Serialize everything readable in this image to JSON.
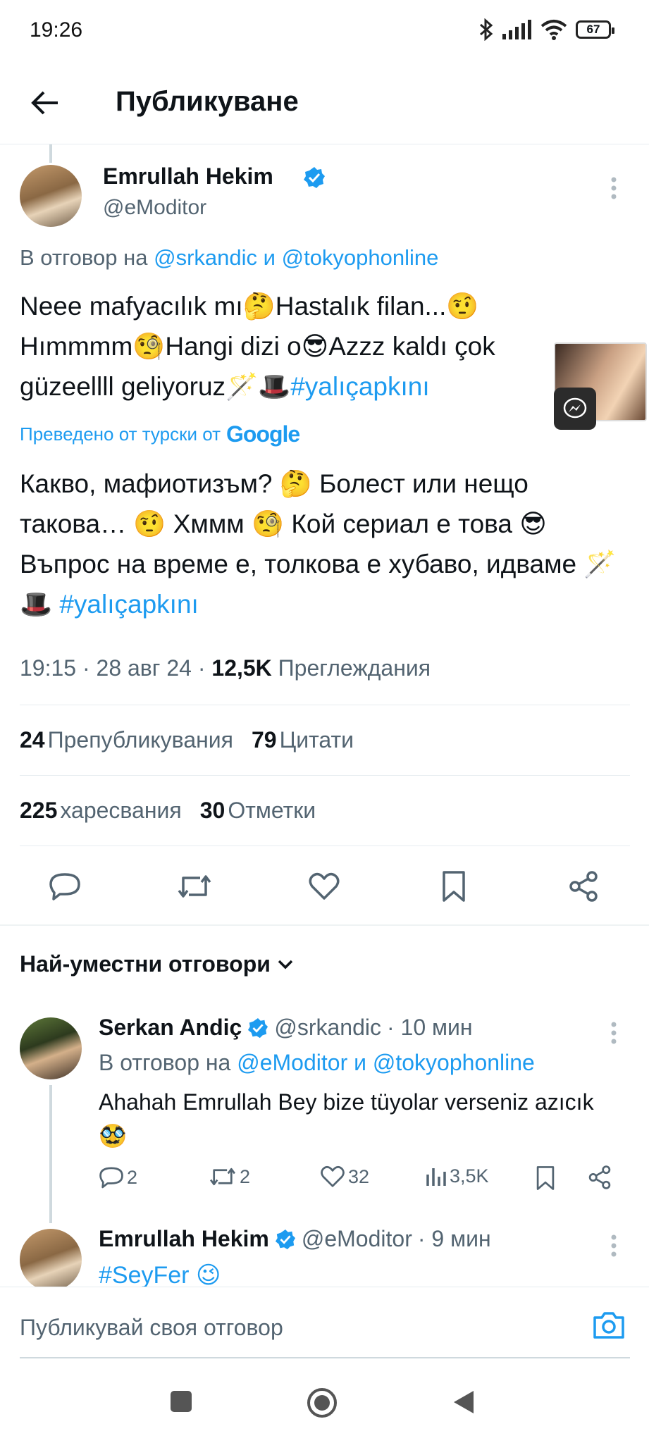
{
  "status": {
    "time": "19:26",
    "battery": "67"
  },
  "header": {
    "title": "Публикуване"
  },
  "tweet": {
    "author": "Emrullah Hekim",
    "handle": "@eModitor",
    "reply_prefix": "В отговор на",
    "reply_user1": "@srkandic",
    "reply_and": "и",
    "reply_user2": "@tokyophonline",
    "text_line1": "Neee mafyacılık mı🤔Hastalık filan...🤨",
    "text_line2": "Hımmmm🧐Hangi dizi o😎Azzz kaldı çok",
    "text_line3_plain": "güzeellll geliyoruz🪄🎩",
    "text_line3_tag": "#yalıçapkını",
    "translated_by": "Преведено от турски от",
    "google": "Google",
    "translation": "Какво, мафиотизъм? 🤔 Болест или нещо такова… 🤨 Хммм 🧐 Кой сериал е това 😎 Въпрос на време е, толкова е хубаво, идваме 🪄🎩",
    "translation_tag": "#yalıçapkını",
    "time": "19:15",
    "date": "28 авг 24",
    "views": "12,5K",
    "views_label": "Преглеждания",
    "reposts": "24",
    "reposts_label": "Препубликувания",
    "quotes": "79",
    "quotes_label": "Цитати",
    "likes": "225",
    "likes_label": "харесвания",
    "bookmarks": "30",
    "bookmarks_label": "Отметки"
  },
  "replies_header": {
    "label": "Най-уместни отговори"
  },
  "reply1": {
    "author": "Serkan Andiç",
    "handle": "@srkandic",
    "time": "· 10 мин",
    "reply_prefix": "В отговор на",
    "reply_user1": "@eModitor",
    "reply_and": "и",
    "reply_user2": "@tokyophonline",
    "text": "Ahahah Emrullah Bey bize tüyolar verseniz azıcık 🥸",
    "replies": "2",
    "reposts": "2",
    "likes": "32",
    "views": "3,5K"
  },
  "reply2": {
    "author": "Emrullah Hekim",
    "handle": "@eModitor",
    "time": "· 9 мин",
    "text": "#SeyFer 😉"
  },
  "compose": {
    "placeholder": "Публикувай своя отговор"
  },
  "colors": {
    "accent": "#1d9bf0",
    "muted": "#536471",
    "text": "#0f1419"
  },
  "icons": [
    "back-arrow-icon",
    "verified-badge-icon",
    "more-vertical-icon",
    "reply-icon",
    "repost-icon",
    "like-icon",
    "bookmark-icon",
    "share-icon",
    "views-icon",
    "camera-icon",
    "chevron-down-icon",
    "messenger-icon"
  ]
}
